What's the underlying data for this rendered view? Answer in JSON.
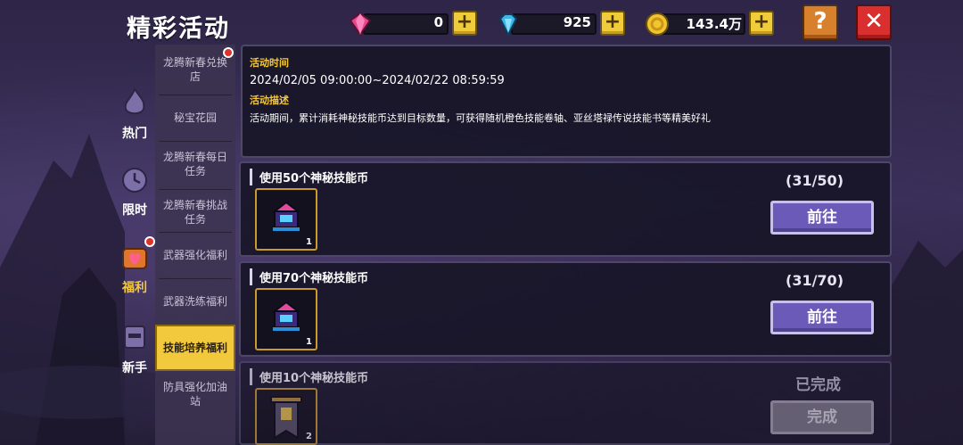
{
  "title": "精彩活动",
  "currency": [
    {
      "icon": "pink-gem-icon",
      "value": "0"
    },
    {
      "icon": "blue-diamond-icon",
      "value": "925"
    },
    {
      "icon": "gold-coin-icon",
      "value": "143.4万"
    }
  ],
  "buttons": {
    "help": "?",
    "close": "✕",
    "plus": "+"
  },
  "categories": [
    {
      "label": "热门",
      "icon": "hot-flame-icon"
    },
    {
      "label": "限时",
      "icon": "clock-icon"
    },
    {
      "label": "福利",
      "icon": "gift-heart-icon"
    },
    {
      "label": "新手",
      "icon": "beginner-helmet-icon"
    }
  ],
  "submenu": [
    "龙腾新春兑换店",
    "秘宝花园",
    "龙腾新春每日任务",
    "龙腾新春挑战任务",
    "武器强化福利",
    "武器洗练福利",
    "技能培养福利",
    "防具强化加油站"
  ],
  "info": {
    "time_heading": "活动时间",
    "time_value": "2024/02/05 09:00:00~2024/02/22 08:59:59",
    "desc_heading": "活动描述",
    "desc_value": "活动期间，累计消耗神秘技能币达到目标数量，可获得随机橙色技能卷轴、亚丝塔禄传说技能书等精美好礼"
  },
  "tasks": [
    {
      "title": "使用50个神秘技能币",
      "progress": "(31/50)",
      "reward_qty": "1",
      "button": "前往"
    },
    {
      "title": "使用70个神秘技能币",
      "progress": "(31/70)",
      "reward_qty": "1",
      "button": "前往"
    },
    {
      "title": "使用10个神秘技能币",
      "status": "已完成",
      "reward_qty": "2",
      "button": "完成"
    }
  ]
}
